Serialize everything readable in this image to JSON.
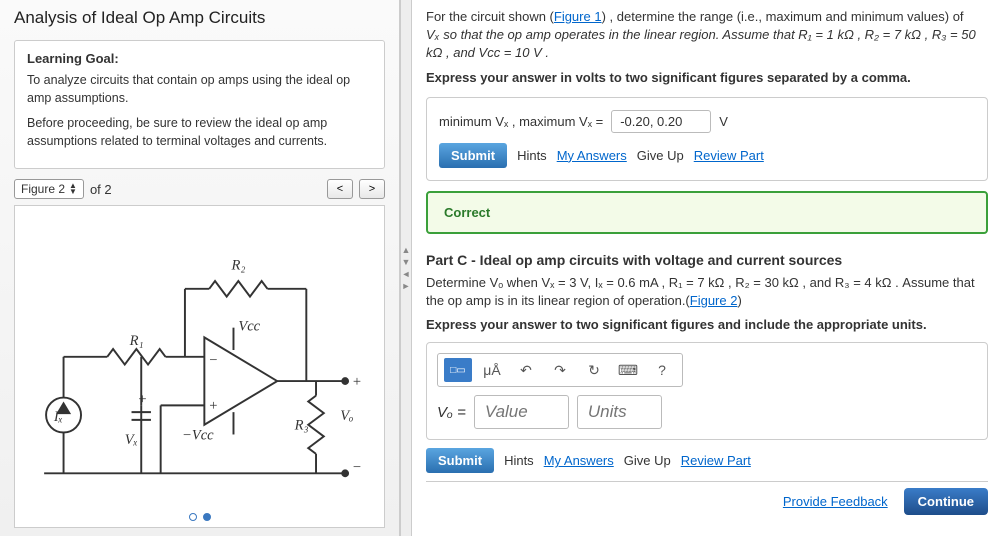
{
  "left": {
    "title": "Analysis of Ideal Op Amp Circuits",
    "goal_heading": "Learning Goal:",
    "goal_p1": "To analyze circuits that contain op amps using the ideal op amp assumptions.",
    "goal_p2": "Before proceeding, be sure to review the ideal op amp assumptions related to terminal voltages and currents.",
    "figure_label": "Figure 2",
    "figure_of": "of 2",
    "prev": "<",
    "next": ">",
    "circuit_labels": {
      "R1": "R₁",
      "R2": "R₂",
      "R3": "R₃",
      "Ix": "Iₓ",
      "Vx": "Vₓ",
      "Vo": "Vₒ",
      "Vccp": "Vcc",
      "Vccn": "−Vcc",
      "plus": "+",
      "minus": "−"
    }
  },
  "right": {
    "topA_l1": "For the circuit shown (",
    "topA_fig": "Figure 1",
    "topA_l2": ") , determine the range (i.e., maximum and minimum values) of ",
    "topA_l3": "Vₓ so that the op amp operates in the linear region. Assume that R₁ = 1 kΩ , R₂ = 7 kΩ , R₃ = 50 kΩ , and Vcc = 10 V .",
    "expressA": "Express your answer in volts to two significant figures separated by a comma.",
    "ansA_label": "minimum Vₓ , maximum Vₓ  =",
    "ansA_value": "-0.20, 0.20",
    "ansA_units": "V",
    "submit": "Submit",
    "hints": "Hints",
    "my_answers": "My Answers",
    "give_up": "Give Up",
    "review": "Review Part",
    "correct": "Correct",
    "partC_title": "Part C - Ideal op amp circuits with voltage and current sources",
    "partC_text1": "Determine Vₒ when Vₓ = 3 V, Iₓ = 0.6 mA , R₁ = 7 kΩ , R₂ = 30 kΩ , and R₃ = 4 kΩ . Assume that the op amp is in its linear region of operation.(",
    "partC_fig": "Figure 2",
    "partC_text2": ")",
    "expressC": "Express your answer to two significant figures and include the appropriate units.",
    "toolbar": {
      "frac": "□▭",
      "mua": "μÅ",
      "undo": "↶",
      "redo": "↷",
      "reset": "↻",
      "keyboard": "⌨",
      "help": "?"
    },
    "Vo_label": "Vₒ =",
    "value_ph": "Value",
    "units_ph": "Units",
    "provide_feedback": "Provide Feedback",
    "continue": "Continue"
  }
}
